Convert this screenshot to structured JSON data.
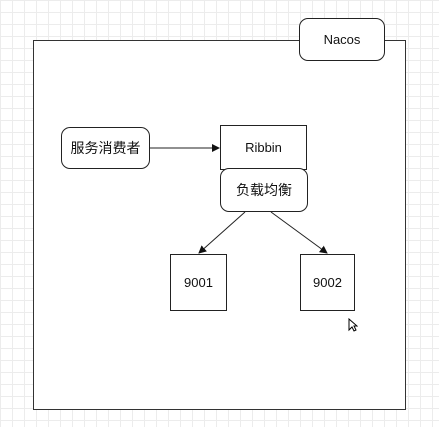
{
  "diagram": {
    "nodes": {
      "nacos": "Nacos",
      "consumer": "服务消费者",
      "ribbin": "Ribbin",
      "load_balance": "负载均衡",
      "server1": "9001",
      "server2": "9002"
    },
    "edges": [
      {
        "from": "consumer",
        "to": "ribbin"
      },
      {
        "from": "load_balance",
        "to": "server1"
      },
      {
        "from": "load_balance",
        "to": "server2"
      }
    ],
    "colors": {
      "stroke": "#222222",
      "grid": "#ececec",
      "background": "#ffffff"
    }
  }
}
